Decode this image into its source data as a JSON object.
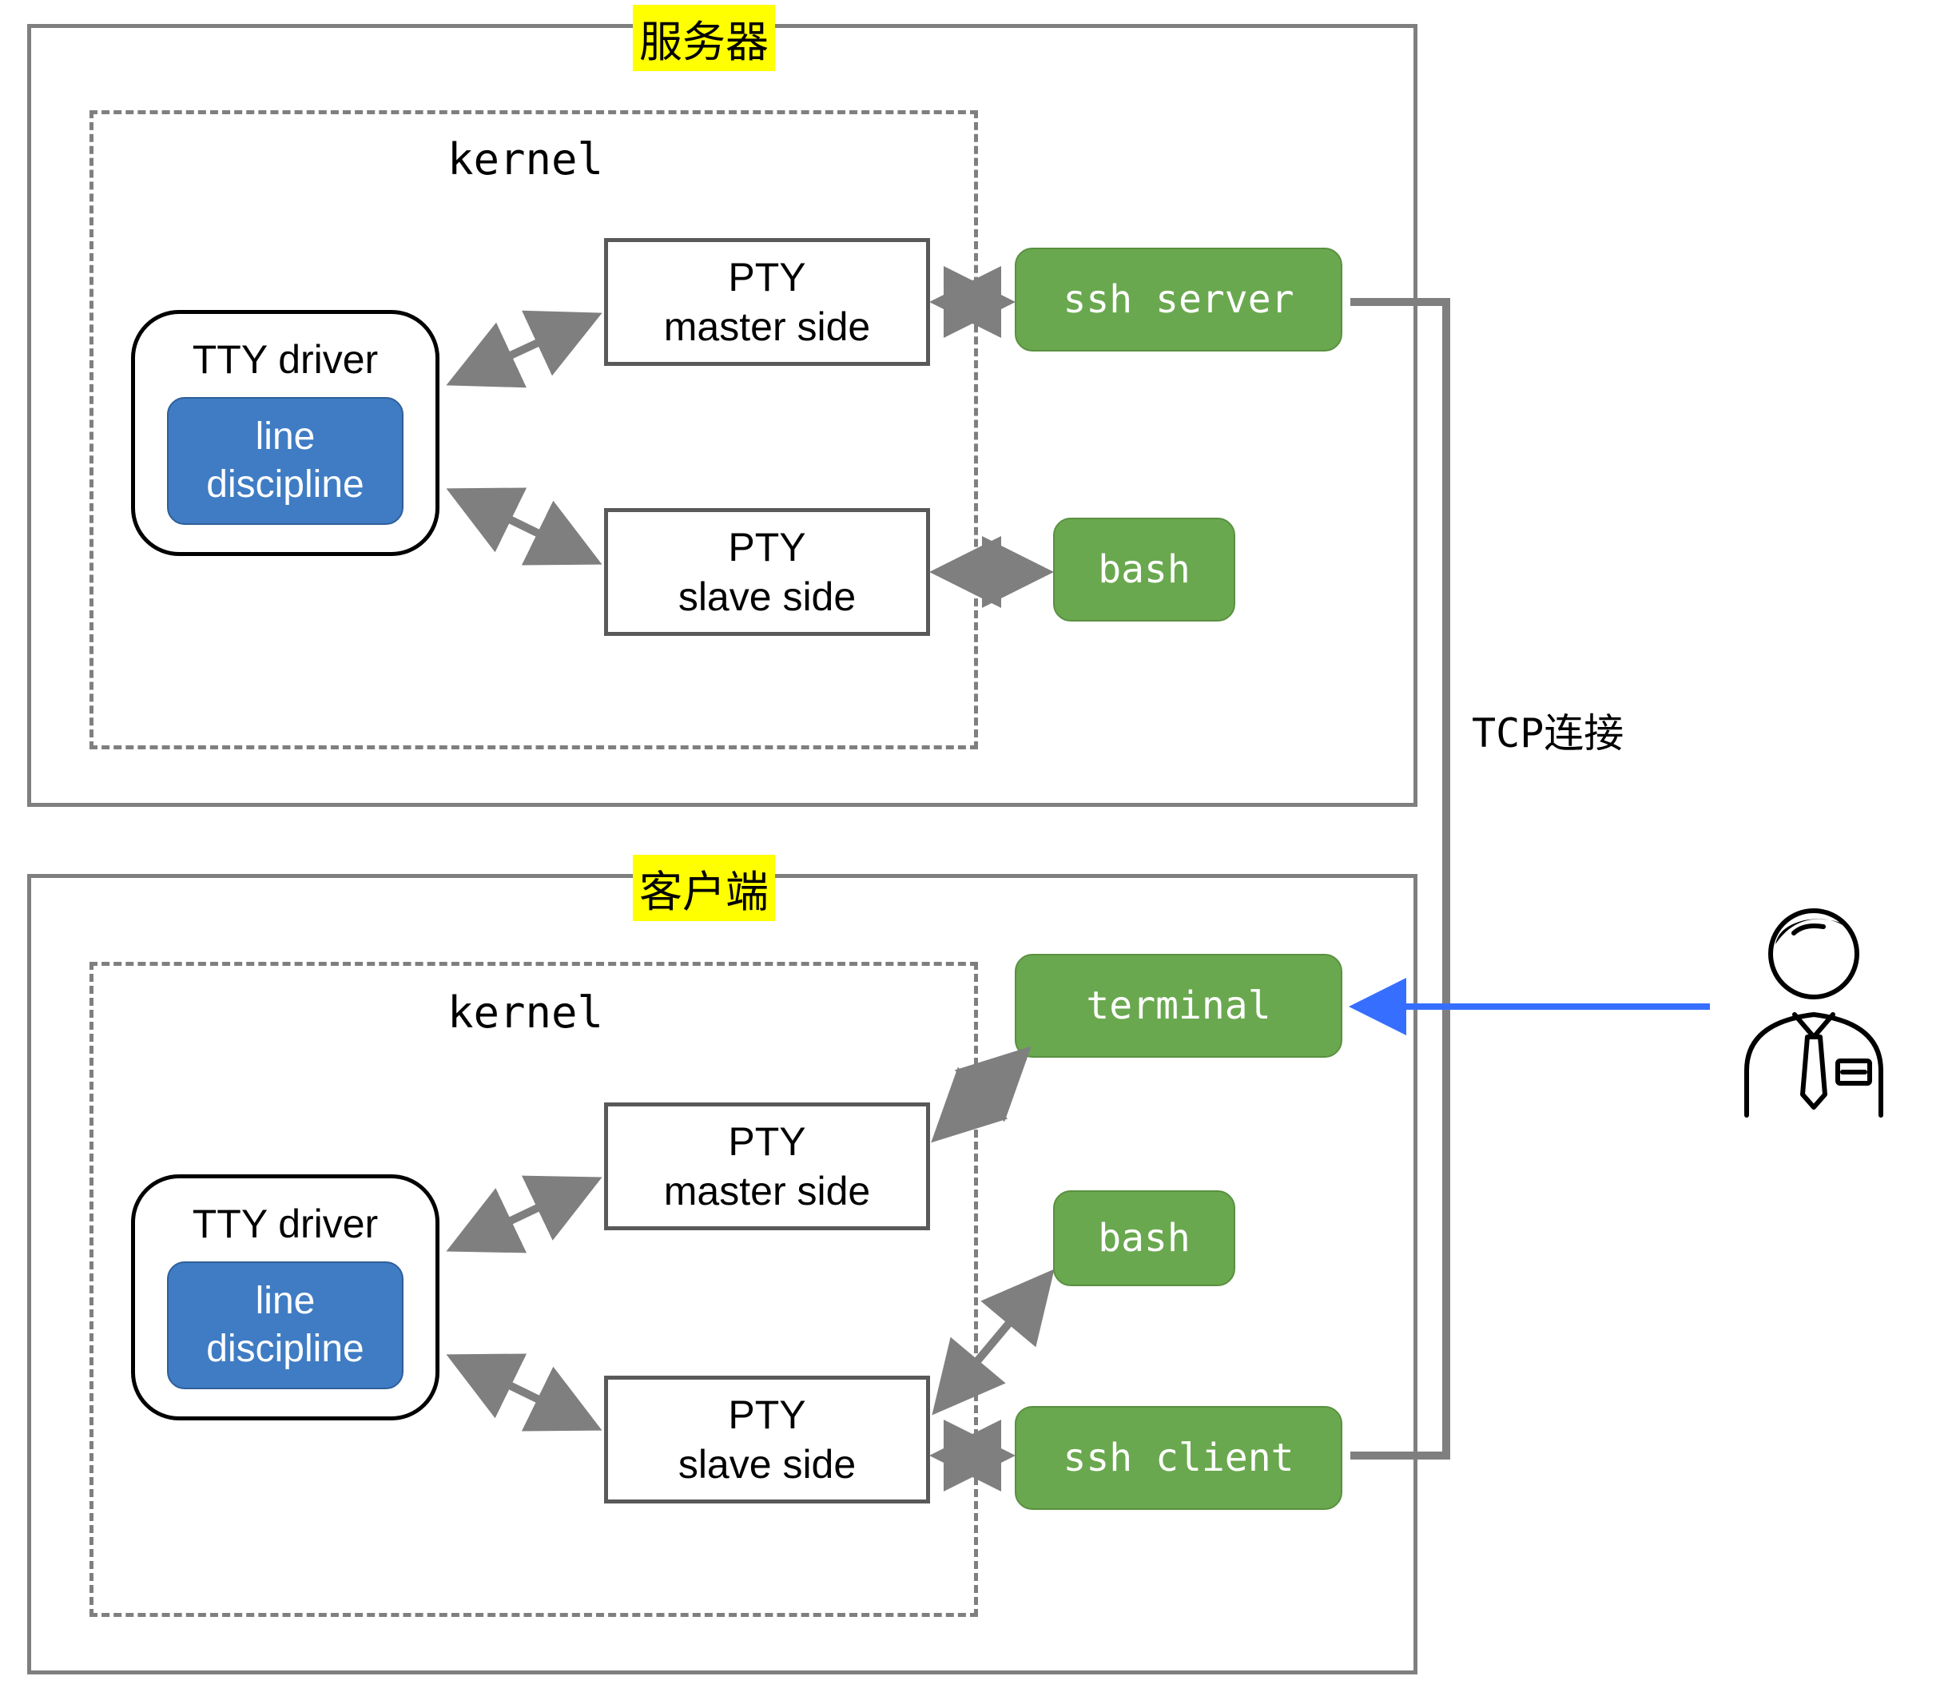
{
  "server": {
    "title": "服务器",
    "kernel": "kernel",
    "tty_driver": "TTY driver",
    "line_discipline": "line\ndiscipline",
    "pty_master": "PTY\nmaster side",
    "pty_slave": "PTY\nslave side",
    "ssh_server": "ssh server",
    "bash": "bash"
  },
  "client": {
    "title": "客户端",
    "kernel": "kernel",
    "tty_driver": "TTY driver",
    "line_discipline": "line\ndiscipline",
    "pty_master": "PTY\nmaster side",
    "pty_slave": "PTY\nslave side",
    "terminal": "terminal",
    "bash": "bash",
    "ssh_client": "ssh client"
  },
  "tcp_label": "TCP连接",
  "colors": {
    "border_gray": "#7f7f7f",
    "box_green": "#6aa84f",
    "box_blue": "#3f7cc4",
    "highlight": "#ffff00",
    "arrow_gray": "#7f7f7f",
    "arrow_blue": "#366fff"
  }
}
